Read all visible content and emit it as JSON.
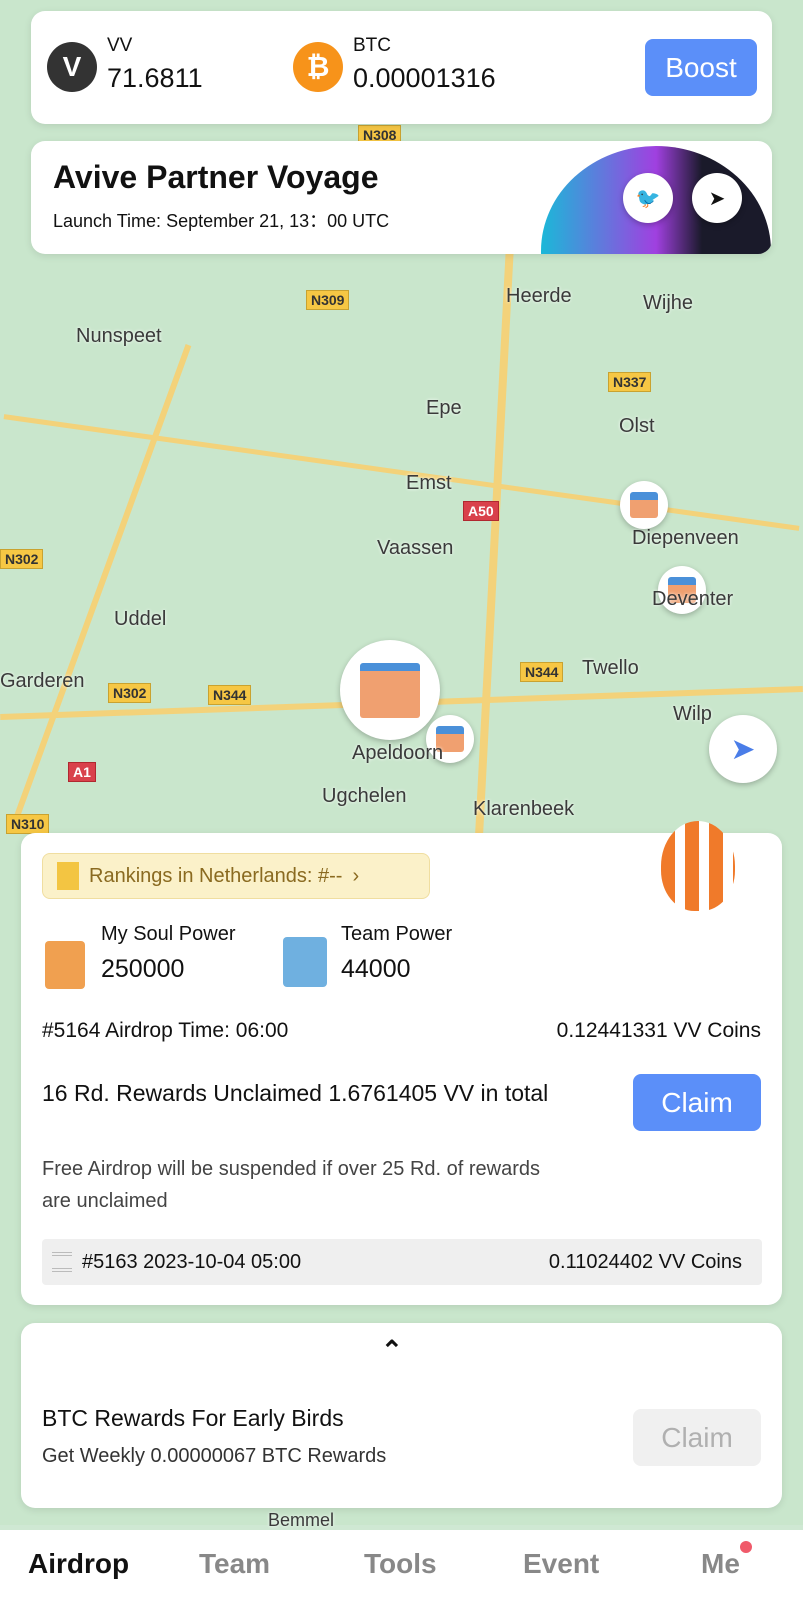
{
  "balances": {
    "vv": {
      "label": "VV",
      "value": "71.6811"
    },
    "btc": {
      "label": "BTC",
      "value": "0.00001316"
    },
    "boost_label": "Boost"
  },
  "banner": {
    "title": "Avive Partner Voyage",
    "subtitle": "Launch Time: September 21, 13：00 UTC",
    "icons": [
      "twitter-icon",
      "telegram-icon"
    ]
  },
  "map": {
    "labels": [
      "Heerde",
      "Wijhe",
      "Nunspeet",
      "Epe",
      "Olst",
      "Emst",
      "Diepenveen",
      "Vaassen",
      "Uddel",
      "Twello",
      "Garderen",
      "Wilp",
      "Ugchelen",
      "Klarenbeek",
      "Apeldoorn",
      "Deventer",
      "Bemmel"
    ],
    "roads": [
      "N309",
      "N337",
      "A50",
      "N302",
      "N344",
      "N302",
      "A1",
      "N310",
      "N344",
      "N308"
    ]
  },
  "airdrop": {
    "ranking": "Rankings in Netherlands: #--",
    "soul_power": {
      "label": "My Soul Power",
      "value": "250000"
    },
    "team_power": {
      "label": "Team Power",
      "value": "44000"
    },
    "next_round": {
      "label": "#5164 Airdrop Time: 06:00",
      "amount": "0.12441331 VV Coins"
    },
    "unclaimed": "16 Rd. Rewards Unclaimed 1.6761405 VV in total",
    "claim_label": "Claim",
    "warning": "Free Airdrop will be suspended if over 25 Rd. of rewards are unclaimed",
    "history": {
      "label": "#5163 2023-10-04 05:00",
      "amount": "0.11024402 VV Coins"
    }
  },
  "btc_rewards": {
    "title": "BTC Rewards For Early Birds",
    "subtitle": "Get Weekly 0.00000067 BTC Rewards",
    "claim_label": "Claim"
  },
  "tabs": [
    {
      "label": "Airdrop",
      "active": true
    },
    {
      "label": "Team"
    },
    {
      "label": "Tools"
    },
    {
      "label": "Event"
    },
    {
      "label": "Me",
      "badge": true
    }
  ],
  "colors": {
    "accent": "#5b8ff9",
    "btc": "#f7931a",
    "badge": "#f05a6a"
  }
}
